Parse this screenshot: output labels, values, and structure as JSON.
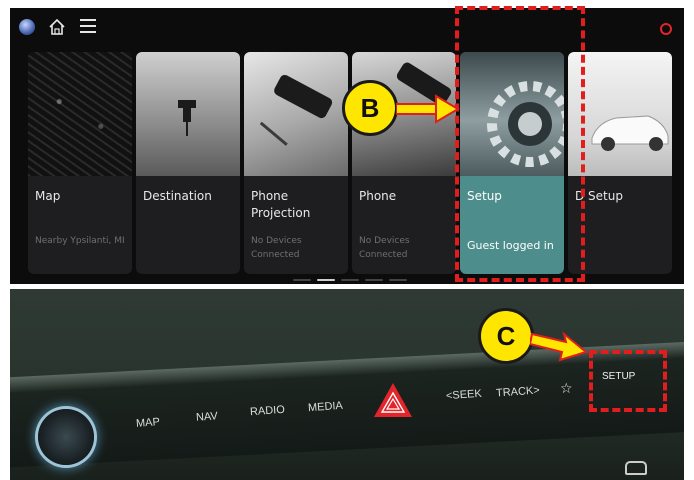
{
  "top_screen": {
    "cards": [
      {
        "label": "Map",
        "sub": "Nearby Ypsilanti, MI"
      },
      {
        "label": "Destination",
        "sub": ""
      },
      {
        "label": "Phone Projection",
        "sub": "No Devices Connected"
      },
      {
        "label": "Phone",
        "sub": "No Devices Connected"
      },
      {
        "label": "Setup",
        "sub": "Guest logged in"
      },
      {
        "label": "D Setup",
        "sub": ""
      }
    ],
    "icons": [
      "globe-icon",
      "home-icon",
      "menu-icon",
      "status-icon"
    ]
  },
  "dashboard": {
    "buttons": {
      "map": "MAP",
      "nav": "NAV",
      "radio": "RADIO",
      "media": "MEDIA",
      "seek": "<SEEK",
      "track": "TRACK>",
      "setup": "SETUP"
    },
    "icons": [
      "volume-knob",
      "hazard-icon",
      "star-icon",
      "car-icon"
    ]
  },
  "annotations": {
    "callout_b": "B",
    "callout_c": "C"
  },
  "colors": {
    "highlight": "#e01e1e",
    "callout_fill": "#ffe600",
    "setup_card": "#4d8e8c"
  }
}
